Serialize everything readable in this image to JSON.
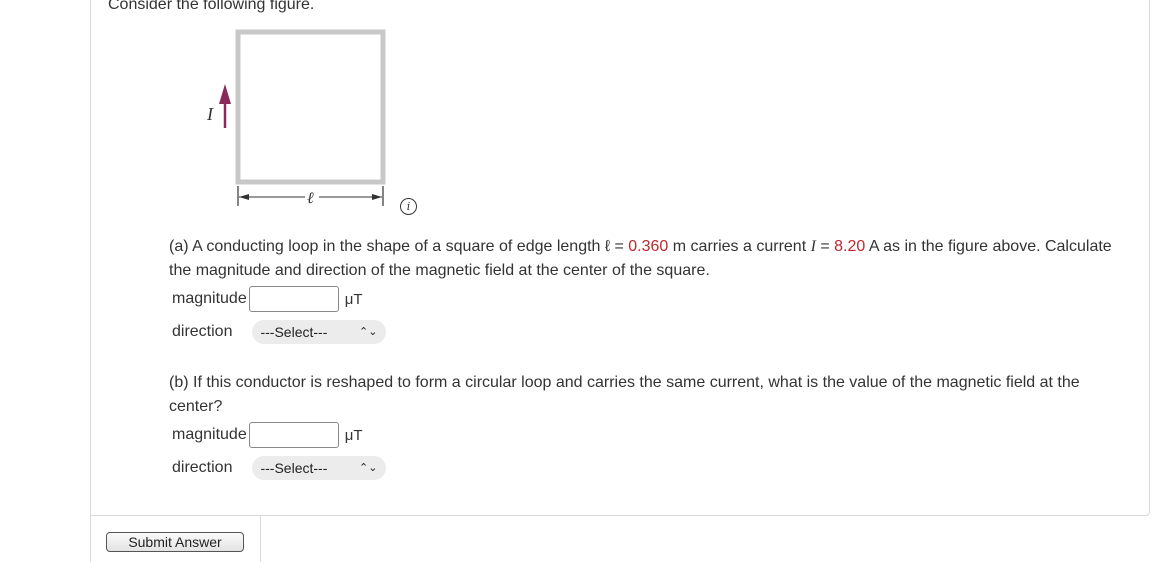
{
  "intro": "Consider the following figure.",
  "figure": {
    "current_label": "I",
    "length_label": "ℓ",
    "info_icon_glyph": "i",
    "arrow_color": "#8b2a5a"
  },
  "part_a": {
    "text_1": "(a) A conducting loop in the shape of a square of edge length ℓ = ",
    "length_value": "0.360",
    "text_2": " m carries a current ",
    "current_symbol": "I",
    "text_3": " = ",
    "current_value": "8.20",
    "text_4": " A as in the figure above. Calculate the magnitude and direction of the magnetic field at the center of the square.",
    "magnitude_label": "magnitude",
    "magnitude_value": "",
    "unit": "μT",
    "direction_label": "direction",
    "direction_selected": "---Select---"
  },
  "part_b": {
    "text": "(b) If this conductor is reshaped to form a circular loop and carries the same current, what is the value of the magnetic field at the center?",
    "magnitude_label": "magnitude",
    "magnitude_value": "",
    "unit": "μT",
    "direction_label": "direction",
    "direction_selected": "---Select---"
  },
  "submit_label": "Submit Answer",
  "colors": {
    "highlight_red": "#c0282d",
    "border_gray": "#d9d9d9"
  }
}
